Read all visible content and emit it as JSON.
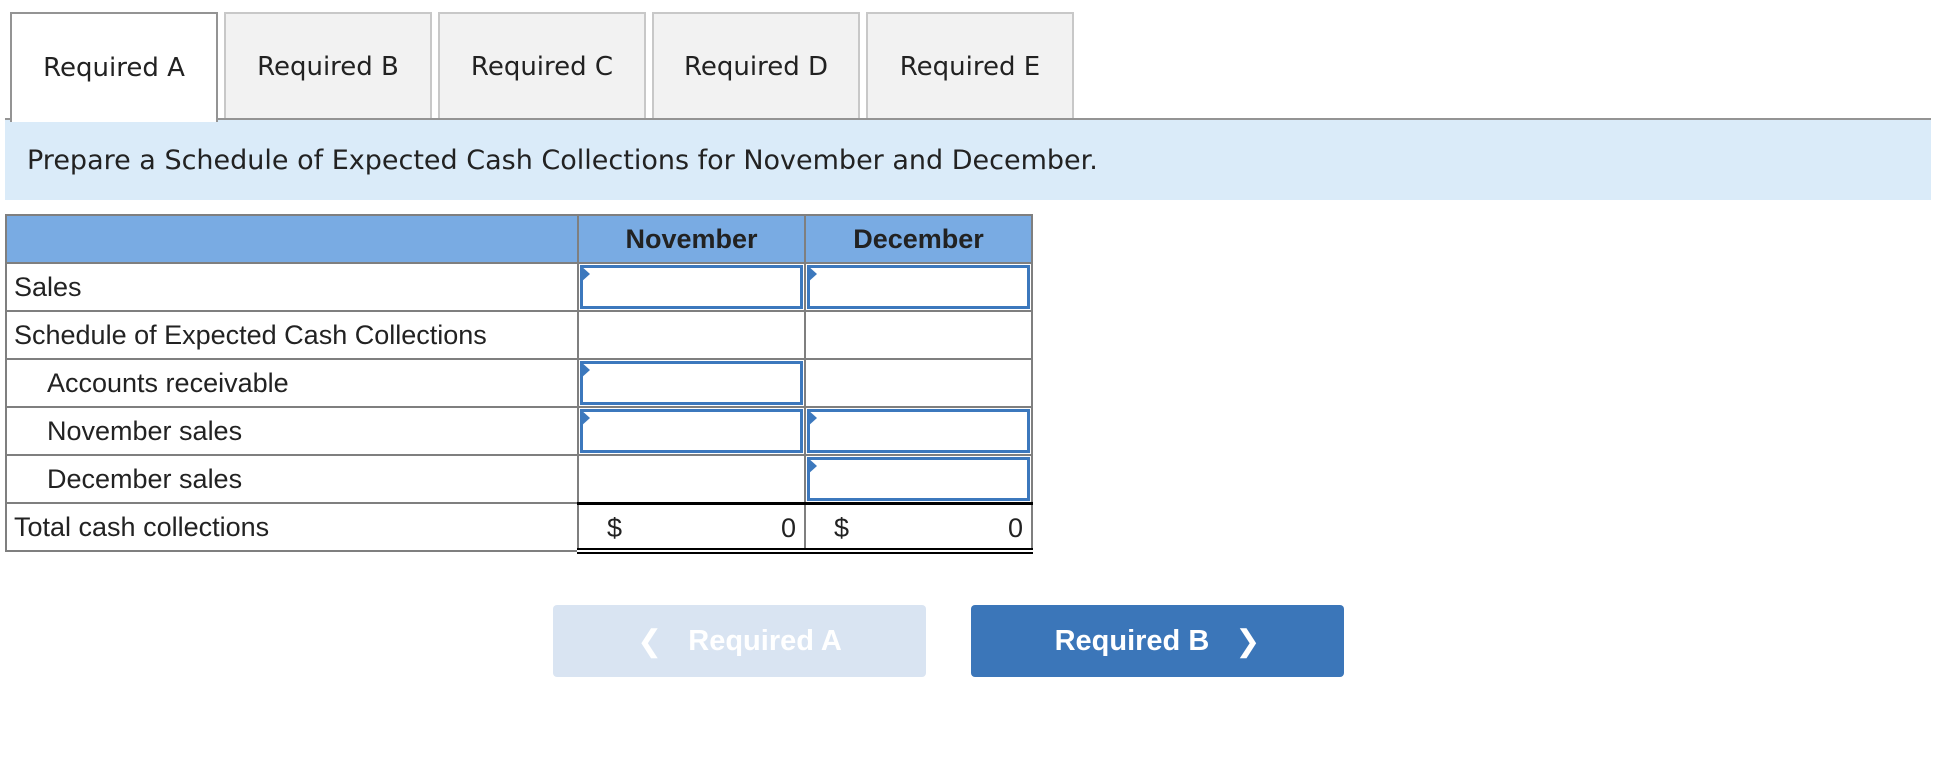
{
  "tabs": [
    {
      "label": "Required A",
      "active": true
    },
    {
      "label": "Required B",
      "active": false
    },
    {
      "label": "Required C",
      "active": false
    },
    {
      "label": "Required D",
      "active": false
    },
    {
      "label": "Required E",
      "active": false
    }
  ],
  "instruction": "Prepare a Schedule of Expected Cash Collections for November and December.",
  "table": {
    "headers": [
      "",
      "November",
      "December"
    ],
    "rows": [
      {
        "label": "Sales",
        "november": "",
        "december": ""
      },
      {
        "label": "Schedule of Expected Cash Collections"
      },
      {
        "label": "Accounts receivable",
        "november": ""
      },
      {
        "label": "November sales",
        "november": "",
        "december": ""
      },
      {
        "label": "December sales",
        "december": ""
      },
      {
        "label": "Total cash collections",
        "november_currency": "$",
        "november_value": "0",
        "december_currency": "$",
        "december_value": "0"
      }
    ]
  },
  "nav": {
    "prev_label": "Required A",
    "next_label": "Required B",
    "prev_icon": "chevron-left-icon",
    "next_icon": "chevron-right-icon"
  },
  "colors": {
    "header_bg": "#79abe3",
    "prompt_bg": "#daebf9",
    "input_border": "#3c78bd",
    "next_button": "#3b76b9",
    "prev_button_disabled": "#d9e4f2"
  }
}
